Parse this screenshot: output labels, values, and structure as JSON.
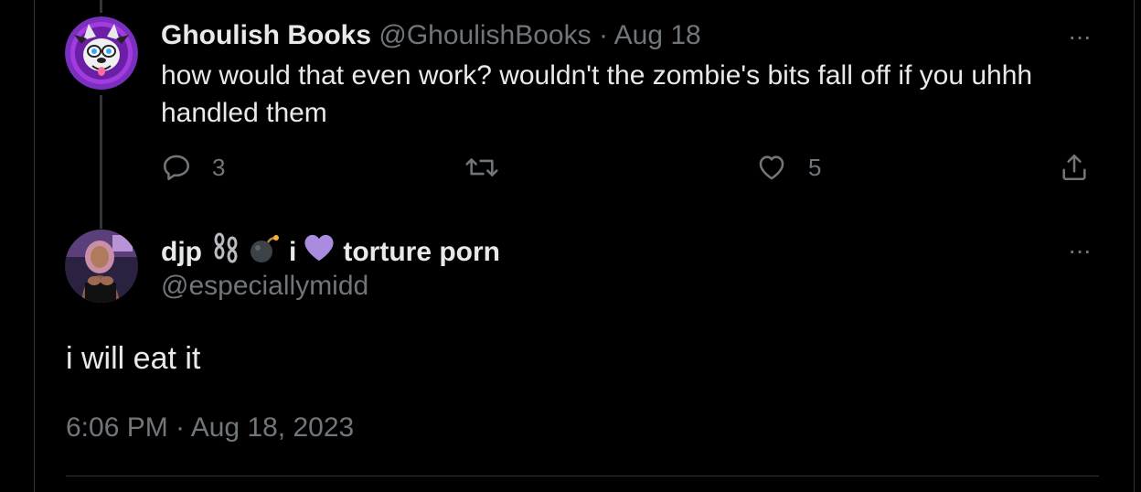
{
  "parent_tweet": {
    "display_name": "Ghoulish Books",
    "handle": "@GhoulishBooks",
    "separator": "·",
    "date": "Aug 18",
    "text": "how would that even work? wouldn't the zombie's bits fall off if you uhhh handled them",
    "more_label": "···",
    "actions": {
      "reply_count": "3",
      "retweet_count": "",
      "like_count": "5"
    },
    "avatar_icon": "werewolf-mascot-avatar"
  },
  "reply_tweet": {
    "display_name_start": "djp",
    "display_name_mid": "i",
    "display_name_end": "torture porn",
    "handle": "@especiallymidd",
    "more_label": "···",
    "text": "i will eat it",
    "timestamp": "6:06 PM · Aug 18, 2023",
    "avatar_icon": "person-photo-avatar",
    "emoji_icons": [
      "chain-emoji",
      "bomb-emoji",
      "purple-heart-emoji"
    ]
  },
  "colors": {
    "background": "#000000",
    "text_primary": "#e7e9ea",
    "text_muted": "#71767b",
    "border": "#2f3336",
    "heart_emoji": "#a98be0"
  }
}
